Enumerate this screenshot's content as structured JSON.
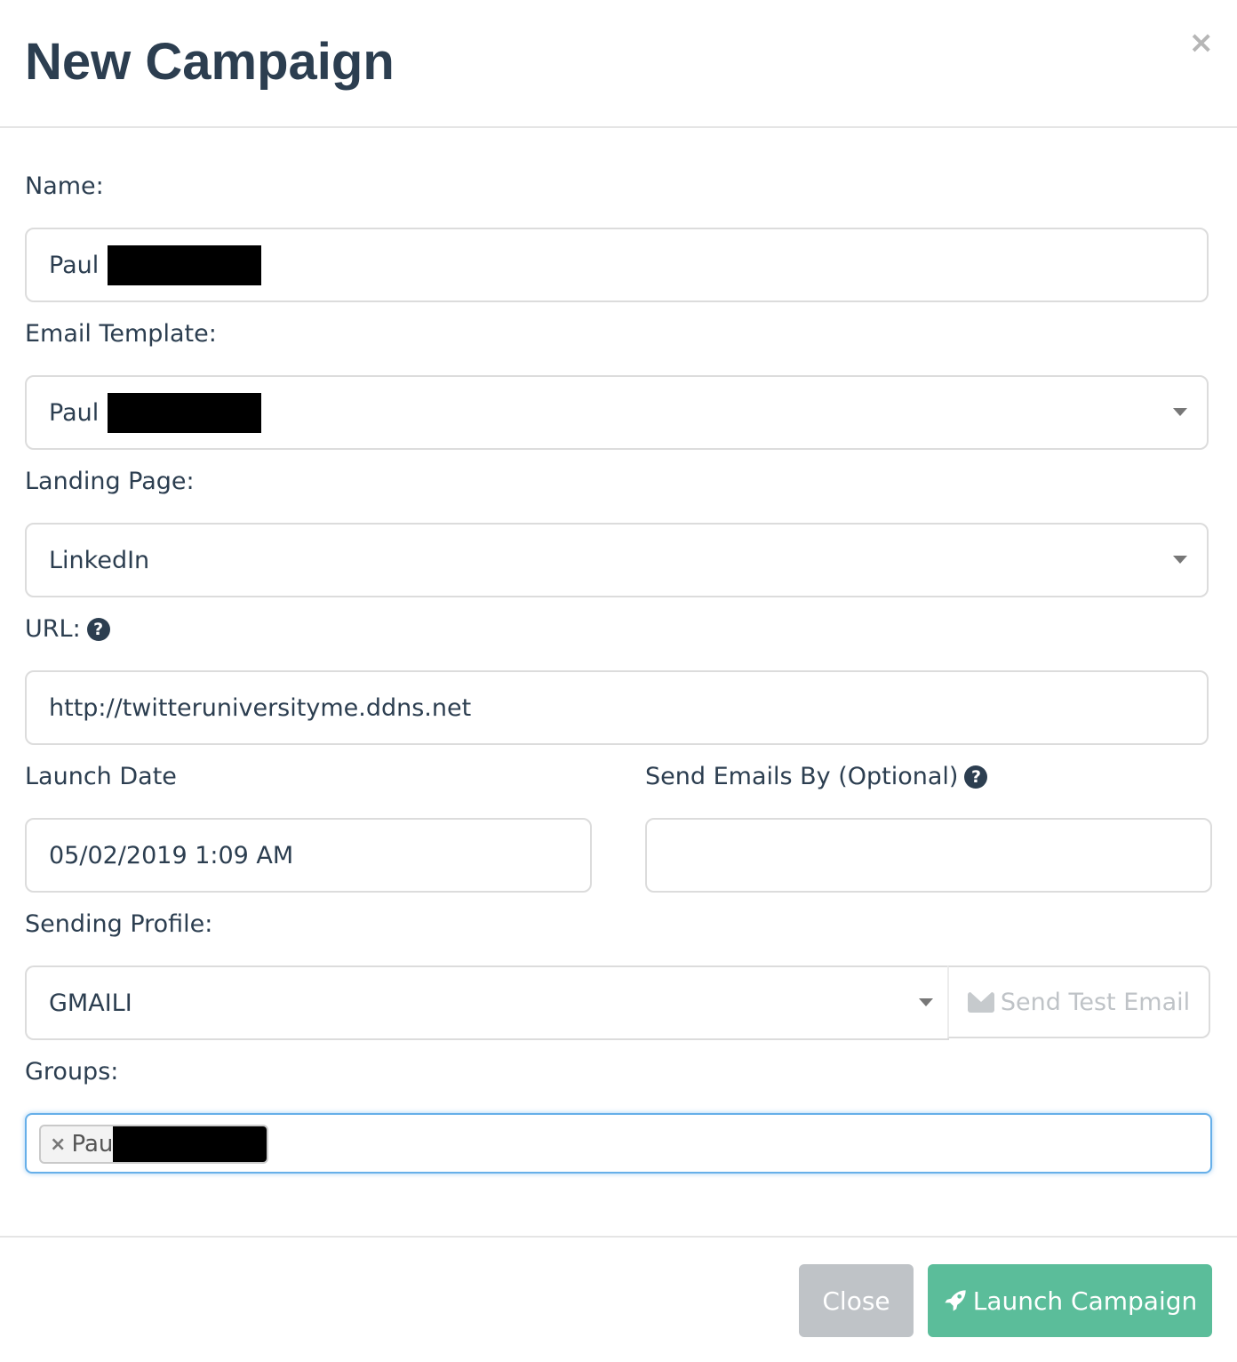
{
  "modal": {
    "title": "New Campaign",
    "close_symbol": "×"
  },
  "form": {
    "name": {
      "label": "Name:",
      "value": "Paul"
    },
    "email_template": {
      "label": "Email Template:",
      "value": "Paul"
    },
    "landing_page": {
      "label": "Landing Page:",
      "value": "LinkedIn"
    },
    "url": {
      "label": "URL:",
      "value": "http://twitteruniversityme.ddns.net",
      "help": "?"
    },
    "launch_date": {
      "label": "Launch Date",
      "value": "05/02/2019 1:09 AM"
    },
    "send_by": {
      "label": "Send Emails By (Optional)",
      "value": "",
      "help": "?"
    },
    "sending_profile": {
      "label": "Sending Profile:",
      "value": "GMAILI",
      "test_button": "Send Test Email"
    },
    "groups": {
      "label": "Groups:",
      "tags": [
        {
          "remove": "×",
          "text": "Pau"
        }
      ]
    }
  },
  "footer": {
    "close_label": "Close",
    "launch_label": "Launch Campaign"
  },
  "colors": {
    "title": "#2c3e50",
    "launch_button": "#5bbd9a",
    "close_button": "#bfc3c7",
    "focus_border": "#66afe9"
  },
  "icons": [
    "close-icon",
    "help-icon",
    "chevron-down-icon",
    "envelope-icon",
    "rocket-icon",
    "remove-tag-icon"
  ]
}
